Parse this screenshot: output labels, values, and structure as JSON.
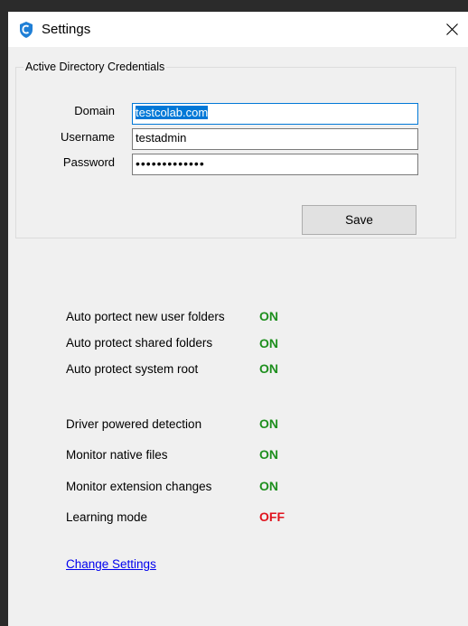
{
  "window": {
    "title": "Settings",
    "close_label": "✕"
  },
  "credentials": {
    "group_label": "Active Directory Credentials",
    "domain_label": "Domain",
    "domain_value": "testcolab.com",
    "username_label": "Username",
    "username_value": "testadmin",
    "password_label": "Password",
    "password_value": "•••••••••••••",
    "save_label": "Save"
  },
  "settings": [
    {
      "label": "Auto portect new user folders",
      "value": "ON",
      "color": "#1e8f1e"
    },
    {
      "label": "Auto protect shared folders",
      "value": "ON",
      "color": "#1e8f1e"
    },
    {
      "label": "Auto protect system root",
      "value": "ON",
      "color": "#1e8f1e"
    },
    {
      "label": "Driver powered detection",
      "value": "ON",
      "color": "#1e8f1e"
    },
    {
      "label": "Monitor native files",
      "value": "ON",
      "color": "#1e8f1e"
    },
    {
      "label": "Monitor extension changes",
      "value": "ON",
      "color": "#1e8f1e"
    },
    {
      "label": "Learning mode",
      "value": "OFF",
      "color": "#e0141e"
    }
  ],
  "change_settings_label": "Change Settings",
  "colors": {
    "on": "#1e8f1e",
    "off": "#e0141e",
    "accent": "#0078d7"
  }
}
